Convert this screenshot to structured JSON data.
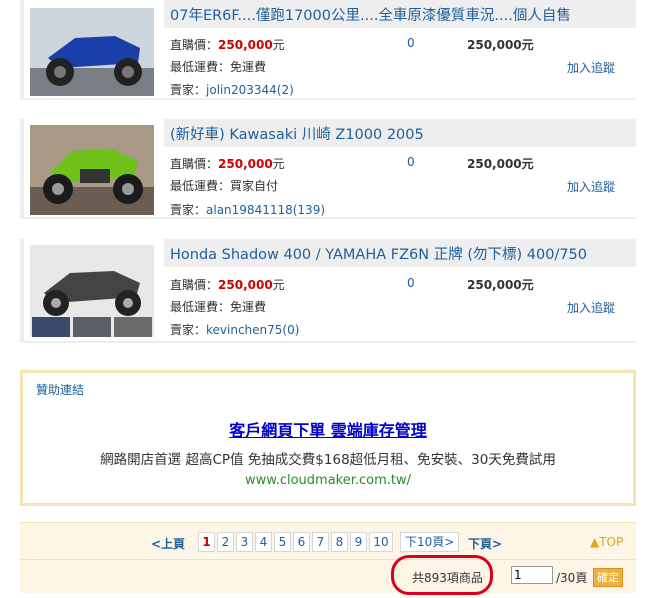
{
  "listings": [
    {
      "title": "07年ER6F....僅跑17000公里....全車原漆優質車況....個人自售",
      "price_label": "直購價：",
      "price_value": "250,000",
      "price_unit": "元",
      "shipping_label": "最低運費：",
      "shipping_value": "免運費",
      "seller_label": "賣家：",
      "seller": "jolin203344(2)",
      "bids": "0",
      "current_price": "250,000元",
      "watch_label": "加入追蹤",
      "thumb_color": "#1a3fa8"
    },
    {
      "title": "(新好車) Kawasaki 川崎 Z1000 2005",
      "price_label": "直購價：",
      "price_value": "250,000",
      "price_unit": "元",
      "shipping_label": "最低運費：",
      "shipping_value": "買家自付",
      "seller_label": "賣家：",
      "seller": "alan19841118(139)",
      "bids": "0",
      "current_price": "250,000元",
      "watch_label": "加入追蹤",
      "thumb_color": "#6fc21a"
    },
    {
      "title": "Honda Shadow 400 / YAMAHA FZ6N 正牌 (勿下標) 400/750",
      "price_label": "直購價：",
      "price_value": "250,000",
      "price_unit": "元",
      "shipping_label": "最低運費：",
      "shipping_value": "免運費",
      "seller_label": "賣家：",
      "seller": "kevinchen75(0)",
      "bids": "0",
      "current_price": "250,000元",
      "watch_label": "加入追蹤",
      "thumb_color": "#888888"
    }
  ],
  "sponsor": {
    "label": "贊助連結",
    "title": "客戶網頁下單 雲端庫存管理",
    "description": "網路開店首選 超高CP值 免抽成交費$168超低月租、免安裝、30天免費試用",
    "url": "www.cloudmaker.com.tw/"
  },
  "pager": {
    "prev_label": "<上頁",
    "pages": [
      "1",
      "2",
      "3",
      "4",
      "5",
      "6",
      "7",
      "8",
      "9",
      "10"
    ],
    "current_page": "1",
    "next10_label": "下10頁>",
    "next_label": "下頁>",
    "top_label": "▲TOP",
    "total_label": "共893項商品",
    "page_input_value": "1",
    "total_pages_label": "/30頁",
    "go_label": "確定"
  }
}
